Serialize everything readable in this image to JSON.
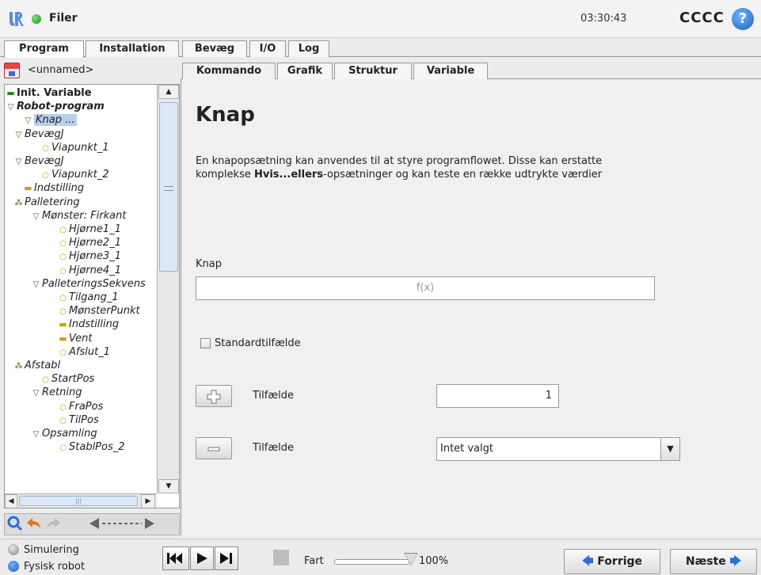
{
  "titlebar": {
    "app_title": "Filer",
    "clock": "03:30:43",
    "robot_name": "CCCC",
    "help": "?"
  },
  "main_tabs": [
    {
      "label": "Program",
      "active": true
    },
    {
      "label": "Installation"
    },
    {
      "label": "Bevæg"
    },
    {
      "label": "I/O"
    },
    {
      "label": "Log"
    }
  ],
  "program_name": "<unnamed>",
  "tree": [
    {
      "label": "Init. Variable",
      "icon": "green-bar-icon"
    },
    {
      "label": "Robot-program",
      "icon": "triangle-icon"
    },
    {
      "label": "Knap ...",
      "icon": "triangle-icon"
    },
    {
      "label": "BevægJ",
      "icon": "triangle-icon"
    },
    {
      "label": "Viapunkt_1",
      "icon": "waypoint-icon"
    },
    {
      "label": "BevægJ",
      "icon": "triangle-icon"
    },
    {
      "label": "Viapunkt_2",
      "icon": "waypoint-icon"
    },
    {
      "label": "Indstilling",
      "icon": "bar-icon"
    },
    {
      "label": "Palletering",
      "icon": "pallet-icon"
    },
    {
      "label": "Mønster: Firkant",
      "icon": "triangle-icon"
    },
    {
      "label": "Hjørne1_1",
      "icon": "waypoint-icon"
    },
    {
      "label": "Hjørne2_1",
      "icon": "waypoint-icon"
    },
    {
      "label": "Hjørne3_1",
      "icon": "waypoint-icon"
    },
    {
      "label": "Hjørne4_1",
      "icon": "waypoint-icon"
    },
    {
      "label": "PalleteringsSekvens",
      "icon": "triangle-icon"
    },
    {
      "label": "Tilgang_1",
      "icon": "waypoint-icon"
    },
    {
      "label": "MønsterPunkt",
      "icon": "waypoint-icon"
    },
    {
      "label": "Indstilling",
      "icon": "bar-icon"
    },
    {
      "label": "Vent",
      "icon": "bar-icon"
    },
    {
      "label": "Afslut_1",
      "icon": "waypoint-icon"
    },
    {
      "label": "Afstabl",
      "icon": "pallet-icon"
    },
    {
      "label": "StartPos",
      "icon": "waypoint-icon"
    },
    {
      "label": "Retning",
      "icon": "triangle-icon"
    },
    {
      "label": "FraPos",
      "icon": "waypoint-icon"
    },
    {
      "label": "TilPos",
      "icon": "waypoint-icon"
    },
    {
      "label": "Opsamling",
      "icon": "triangle-icon"
    },
    {
      "label": "StablPos_2",
      "icon": "waypoint-icon"
    }
  ],
  "sub_tabs": [
    {
      "label": "Kommando",
      "active": true
    },
    {
      "label": "Grafik"
    },
    {
      "label": "Struktur"
    },
    {
      "label": "Variable"
    }
  ],
  "content": {
    "title": "Knap",
    "desc_line1": "En knapopsætning kan anvendes til at styre programflowet. Disse kan erstatte",
    "desc_line2_pre": "komplekse ",
    "desc_line2_bold": "Hvis...ellers",
    "desc_line2_post": "-opsætninger og kan teste en række udtrykte værdier",
    "knap_label": "Knap",
    "fx_placeholder": "f(x)",
    "default_case_label": "Standardtilfælde",
    "default_case_checked": false,
    "add_case_label": "Tilfælde",
    "add_case_value": "1",
    "remove_case_label": "Tilfælde",
    "remove_case_selected": "Intet valgt"
  },
  "footer": {
    "simulation_label": "Simulering",
    "physical_label": "Fysisk robot",
    "speed_label": "Fart",
    "speed_value": "100%",
    "speed_fraction": 1.0,
    "prev_label": "Forrige",
    "next_label": "Næste"
  },
  "colors": {
    "accent_blue": "#2c6fd1",
    "status_green": "#1e8a1e",
    "selection": "#b8cff0"
  }
}
